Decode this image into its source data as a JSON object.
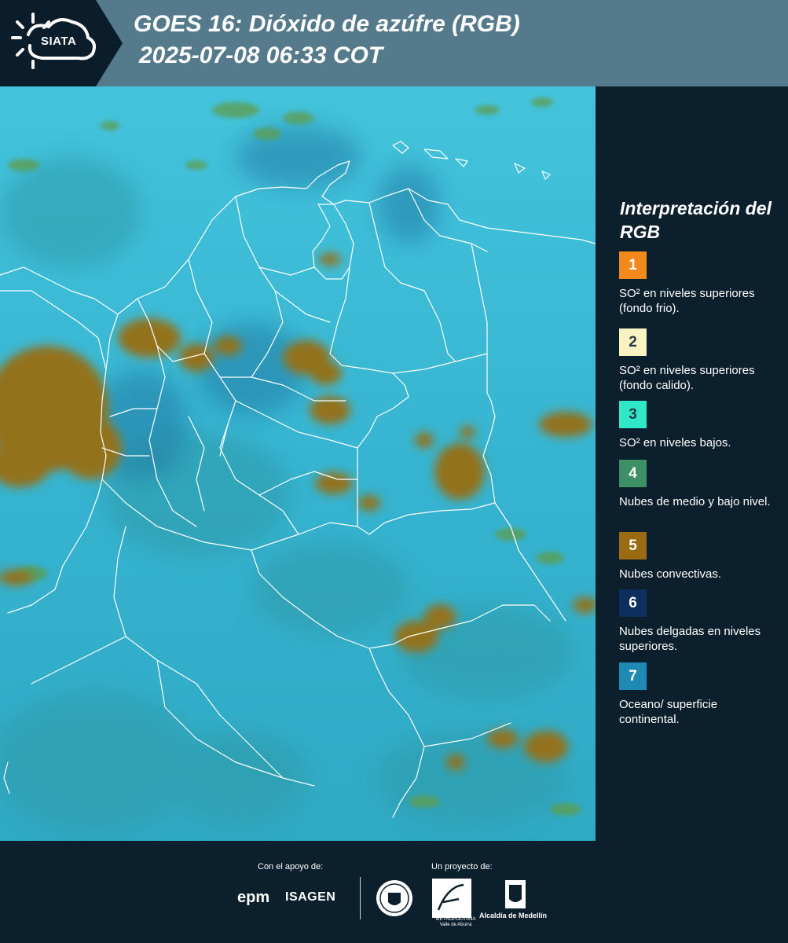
{
  "header": {
    "logo_text": "SIATA",
    "title_line_1": "GOES 16: Dióxido de azúfre (RGB)",
    "title_line_2": "2025-07-08 06:33 COT"
  },
  "legend": {
    "title": "Interpretación del RGB",
    "items": [
      {
        "number": "1",
        "color": "#f28a1b",
        "label": "SO² en niveles superiores (fondo frio)."
      },
      {
        "number": "2",
        "color": "#fbf2c4",
        "label": "SO² en niveles superiores (fondo calido)."
      },
      {
        "number": "3",
        "color": "#2ee8c8",
        "label": "SO² en niveles bajos."
      },
      {
        "number": "4",
        "color": "#3d8f65",
        "label": "Nubes de medio y bajo nivel."
      },
      {
        "number": "5",
        "color": "#9a6b12",
        "label": "Nubes convectivas."
      },
      {
        "number": "6",
        "color": "#0e2f5e",
        "label": "Nubes delgadas en niveles superiores."
      },
      {
        "number": "7",
        "color": "#1e8ab3",
        "label": "Oceano/ superficie continental."
      }
    ]
  },
  "footer": {
    "support_caption": "Con el apoyo de:",
    "project_caption": "Un proyecto de:",
    "epm": "epm",
    "isagen": "ISAGEN",
    "area_caption": "METROPOLITANA Valle de Aburrá",
    "alcaldia_caption": "Alcaldía de Medellín"
  },
  "colors": {
    "header_band": "#557a8b",
    "background": "#0c1f2d",
    "map_base": "#3ab8d4",
    "convective_cloud": "#9a6b12",
    "mid_low_cloud": "#3d8f65"
  }
}
